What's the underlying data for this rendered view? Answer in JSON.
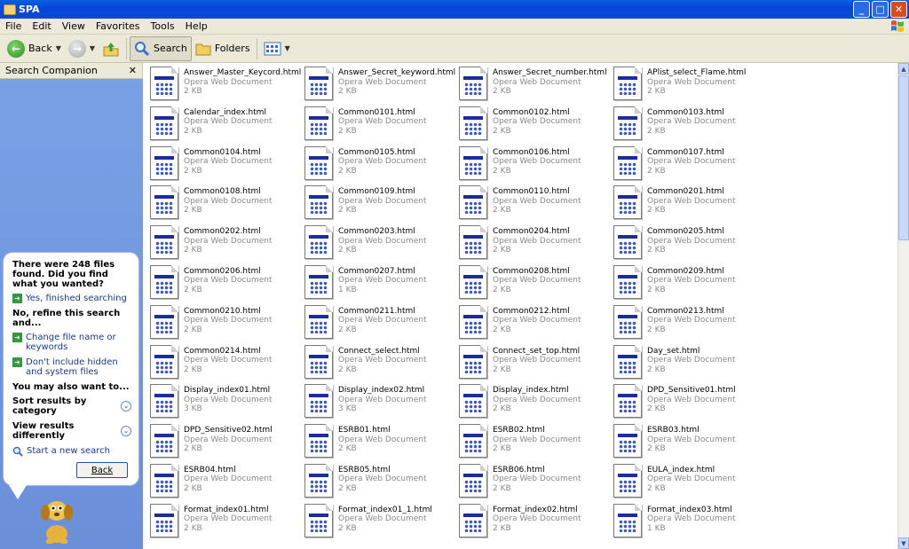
{
  "window": {
    "title": "SPA",
    "icon": "folder-icon",
    "controls": [
      "minimize-icon",
      "maximize-icon",
      "close-icon"
    ]
  },
  "menu": [
    "File",
    "Edit",
    "View",
    "Favorites",
    "Tools",
    "Help"
  ],
  "toolbar": {
    "back_label": "Back",
    "search_label": "Search",
    "folders_label": "Folders"
  },
  "sidebar": {
    "title": "Search Companion",
    "found_text": "There were 248 files found. Did you find what you wanted?",
    "yes_label": "Yes, finished searching",
    "refine_heading": "No, refine this search and...",
    "change_label": "Change file name or keywords",
    "hidden_label": "Don't include hidden and system files",
    "also_heading": "You may also want to...",
    "sort_label": "Sort results by category",
    "view_label": "View results differently",
    "new_search_label": "Start a new search",
    "back_button": "Back"
  },
  "files": [
    {
      "name": "Answer_Master_Keycord.html",
      "type": "Opera Web Document",
      "size": "2 KB"
    },
    {
      "name": "Answer_Secret_keyword.html",
      "type": "Opera Web Document",
      "size": "2 KB"
    },
    {
      "name": "Answer_Secret_number.html",
      "type": "Opera Web Document",
      "size": "2 KB"
    },
    {
      "name": "APlist_select_Flame.html",
      "type": "Opera Web Document",
      "size": "2 KB"
    },
    {
      "name": "Calendar_index.html",
      "type": "Opera Web Document",
      "size": "2 KB"
    },
    {
      "name": "Common0101.html",
      "type": "Opera Web Document",
      "size": "2 KB"
    },
    {
      "name": "Common0102.html",
      "type": "Opera Web Document",
      "size": "2 KB"
    },
    {
      "name": "Common0103.html",
      "type": "Opera Web Document",
      "size": "2 KB"
    },
    {
      "name": "Common0104.html",
      "type": "Opera Web Document",
      "size": "2 KB"
    },
    {
      "name": "Common0105.html",
      "type": "Opera Web Document",
      "size": "2 KB"
    },
    {
      "name": "Common0106.html",
      "type": "Opera Web Document",
      "size": "2 KB"
    },
    {
      "name": "Common0107.html",
      "type": "Opera Web Document",
      "size": "2 KB"
    },
    {
      "name": "Common0108.html",
      "type": "Opera Web Document",
      "size": "2 KB"
    },
    {
      "name": "Common0109.html",
      "type": "Opera Web Document",
      "size": "2 KB"
    },
    {
      "name": "Common0110.html",
      "type": "Opera Web Document",
      "size": "2 KB"
    },
    {
      "name": "Common0201.html",
      "type": "Opera Web Document",
      "size": "2 KB"
    },
    {
      "name": "Common0202.html",
      "type": "Opera Web Document",
      "size": "2 KB"
    },
    {
      "name": "Common0203.html",
      "type": "Opera Web Document",
      "size": "2 KB"
    },
    {
      "name": "Common0204.html",
      "type": "Opera Web Document",
      "size": "2 KB"
    },
    {
      "name": "Common0205.html",
      "type": "Opera Web Document",
      "size": "2 KB"
    },
    {
      "name": "Common0206.html",
      "type": "Opera Web Document",
      "size": "2 KB"
    },
    {
      "name": "Common0207.html",
      "type": "Opera Web Document",
      "size": "1 KB"
    },
    {
      "name": "Common0208.html",
      "type": "Opera Web Document",
      "size": "2 KB"
    },
    {
      "name": "Common0209.html",
      "type": "Opera Web Document",
      "size": "2 KB"
    },
    {
      "name": "Common0210.html",
      "type": "Opera Web Document",
      "size": "2 KB"
    },
    {
      "name": "Common0211.html",
      "type": "Opera Web Document",
      "size": "2 KB"
    },
    {
      "name": "Common0212.html",
      "type": "Opera Web Document",
      "size": "2 KB"
    },
    {
      "name": "Common0213.html",
      "type": "Opera Web Document",
      "size": "2 KB"
    },
    {
      "name": "Common0214.html",
      "type": "Opera Web Document",
      "size": "2 KB"
    },
    {
      "name": "Connect_select.html",
      "type": "Opera Web Document",
      "size": "2 KB"
    },
    {
      "name": "Connect_set_top.html",
      "type": "Opera Web Document",
      "size": "2 KB"
    },
    {
      "name": "Day_set.html",
      "type": "Opera Web Document",
      "size": "2 KB"
    },
    {
      "name": "Display_index01.html",
      "type": "Opera Web Document",
      "size": "3 KB"
    },
    {
      "name": "Display_index02.html",
      "type": "Opera Web Document",
      "size": "3 KB"
    },
    {
      "name": "Display_index.html",
      "type": "Opera Web Document",
      "size": "2 KB"
    },
    {
      "name": "DPD_Sensitive01.html",
      "type": "Opera Web Document",
      "size": "2 KB"
    },
    {
      "name": "DPD_Sensitive02.html",
      "type": "Opera Web Document",
      "size": "2 KB"
    },
    {
      "name": "ESRB01.html",
      "type": "Opera Web Document",
      "size": "2 KB"
    },
    {
      "name": "ESRB02.html",
      "type": "Opera Web Document",
      "size": "2 KB"
    },
    {
      "name": "ESRB03.html",
      "type": "Opera Web Document",
      "size": "2 KB"
    },
    {
      "name": "ESRB04.html",
      "type": "Opera Web Document",
      "size": "2 KB"
    },
    {
      "name": "ESRB05.html",
      "type": "Opera Web Document",
      "size": "2 KB"
    },
    {
      "name": "ESRB06.html",
      "type": "Opera Web Document",
      "size": "2 KB"
    },
    {
      "name": "EULA_index.html",
      "type": "Opera Web Document",
      "size": "2 KB"
    },
    {
      "name": "Format_index01.html",
      "type": "Opera Web Document",
      "size": "2 KB"
    },
    {
      "name": "Format_index01_1.html",
      "type": "Opera Web Document",
      "size": "2 KB"
    },
    {
      "name": "Format_index02.html",
      "type": "Opera Web Document",
      "size": "2 KB"
    },
    {
      "name": "Format_index03.html",
      "type": "Opera Web Document",
      "size": "1 KB"
    }
  ]
}
